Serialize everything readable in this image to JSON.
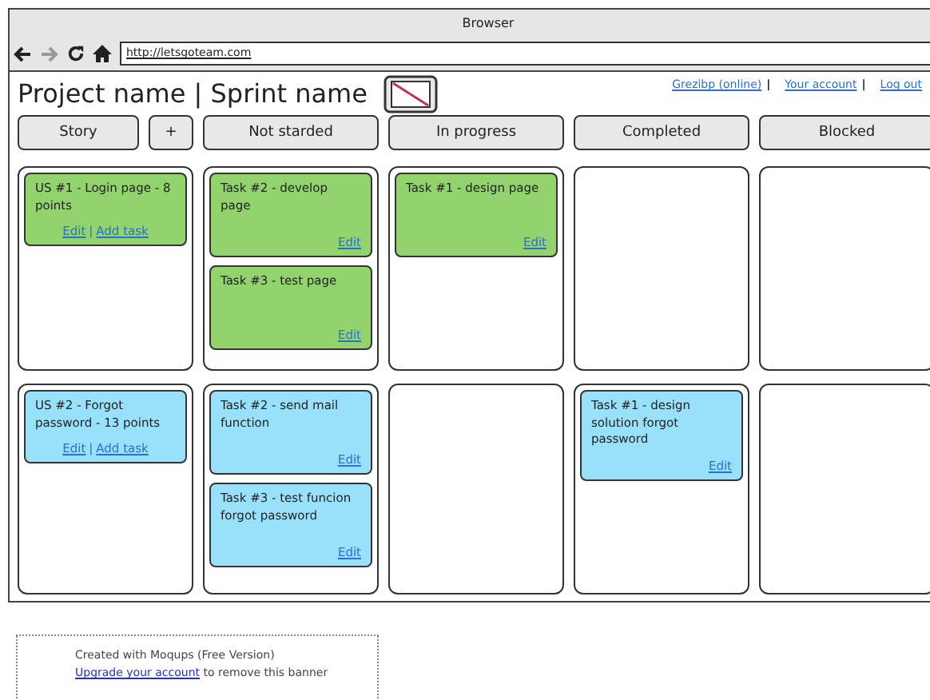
{
  "window": {
    "title": "Browser"
  },
  "address_bar": {
    "url": "http://letsgoteam.com"
  },
  "header": {
    "title": "Project name | Sprint name",
    "user_links": [
      {
        "kind": "link",
        "label": "Grezibp (online)"
      },
      {
        "kind": "separator",
        "label": "|"
      },
      {
        "kind": "link",
        "label": "Your account"
      },
      {
        "kind": "separator",
        "label": "|"
      },
      {
        "kind": "link",
        "label": "Log out"
      }
    ]
  },
  "board": {
    "story_header": "Story",
    "add_button": "+",
    "columns": [
      "Not starded",
      "In progress",
      "Completed",
      "Blocked"
    ],
    "lanes": [
      {
        "color": "#92d36e",
        "story": {
          "title": "US #1 - Login page - 8 points",
          "links": [
            "Edit",
            "Add task"
          ],
          "link_separator": "|"
        },
        "cells": [
          [
            {
              "title": "Task #2 - develop page",
              "link": "Edit"
            },
            {
              "title": "Task #3 - test page",
              "link": "Edit"
            }
          ],
          [
            {
              "title": "Task #1 - design page",
              "link": "Edit"
            }
          ],
          [],
          []
        ]
      },
      {
        "color": "#99e1fa",
        "story": {
          "title": "US #2 - Forgot password - 13 points",
          "links": [
            "Edit",
            "Add task"
          ],
          "link_separator": "|"
        },
        "cells": [
          [
            {
              "title": "Task #2 - send mail function",
              "link": "Edit"
            },
            {
              "title": "Task #3 - test funcion forgot password",
              "link": "Edit"
            }
          ],
          [],
          [
            {
              "title": "Task #1 - design solution forgot password",
              "link": "Edit"
            }
          ],
          []
        ]
      }
    ]
  },
  "banner": {
    "line_1": "Created with Moqups (Free Version)",
    "link": "Upgrade your account",
    "rest": "to remove this banner"
  }
}
